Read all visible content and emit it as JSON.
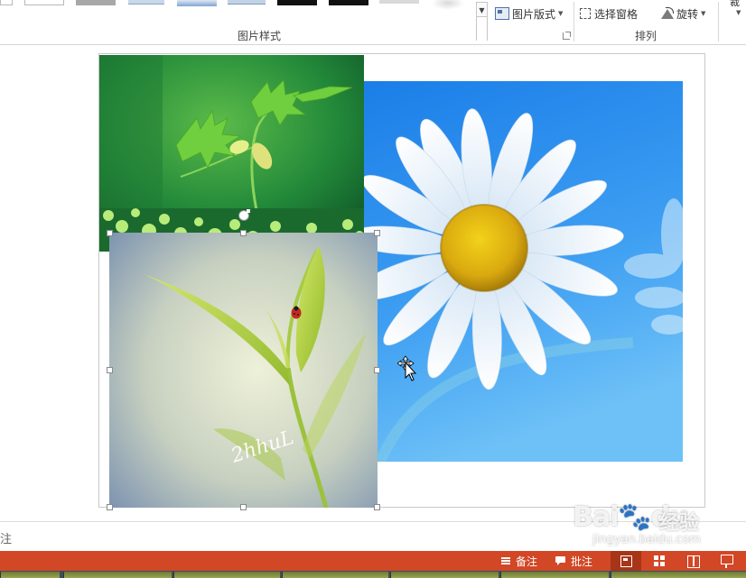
{
  "ribbon": {
    "picture_styles_group_label": "图片样式",
    "arrange_group_label": "排列",
    "picture_layout_label": "图片版式",
    "selection_pane_label": "选择窗格",
    "rotate_label": "旋转",
    "crop_label": "裁",
    "gallery_style_count": 10
  },
  "slide": {
    "images": [
      {
        "name": "daisy-photo",
        "description_icon": "daisy-image"
      },
      {
        "name": "seedling-photo",
        "description_icon": "seedling-image"
      },
      {
        "name": "leaf-ladybug-photo",
        "description_icon": "leaf-image",
        "selected": true
      }
    ],
    "leaf_signature": "2hhuL"
  },
  "notes": {
    "hint_text": "注"
  },
  "statusbar": {
    "notes_label": "备注",
    "comments_label": "批注",
    "active_view": "normal"
  },
  "watermark": {
    "brand": "Bai",
    "brand_suffix": "du",
    "cn_text": "经验",
    "url": "jingyan.baidu.com"
  },
  "colors": {
    "status_bar": "#d24726",
    "active_view": "#a83518",
    "sky_blue": "#2f8ff0"
  }
}
